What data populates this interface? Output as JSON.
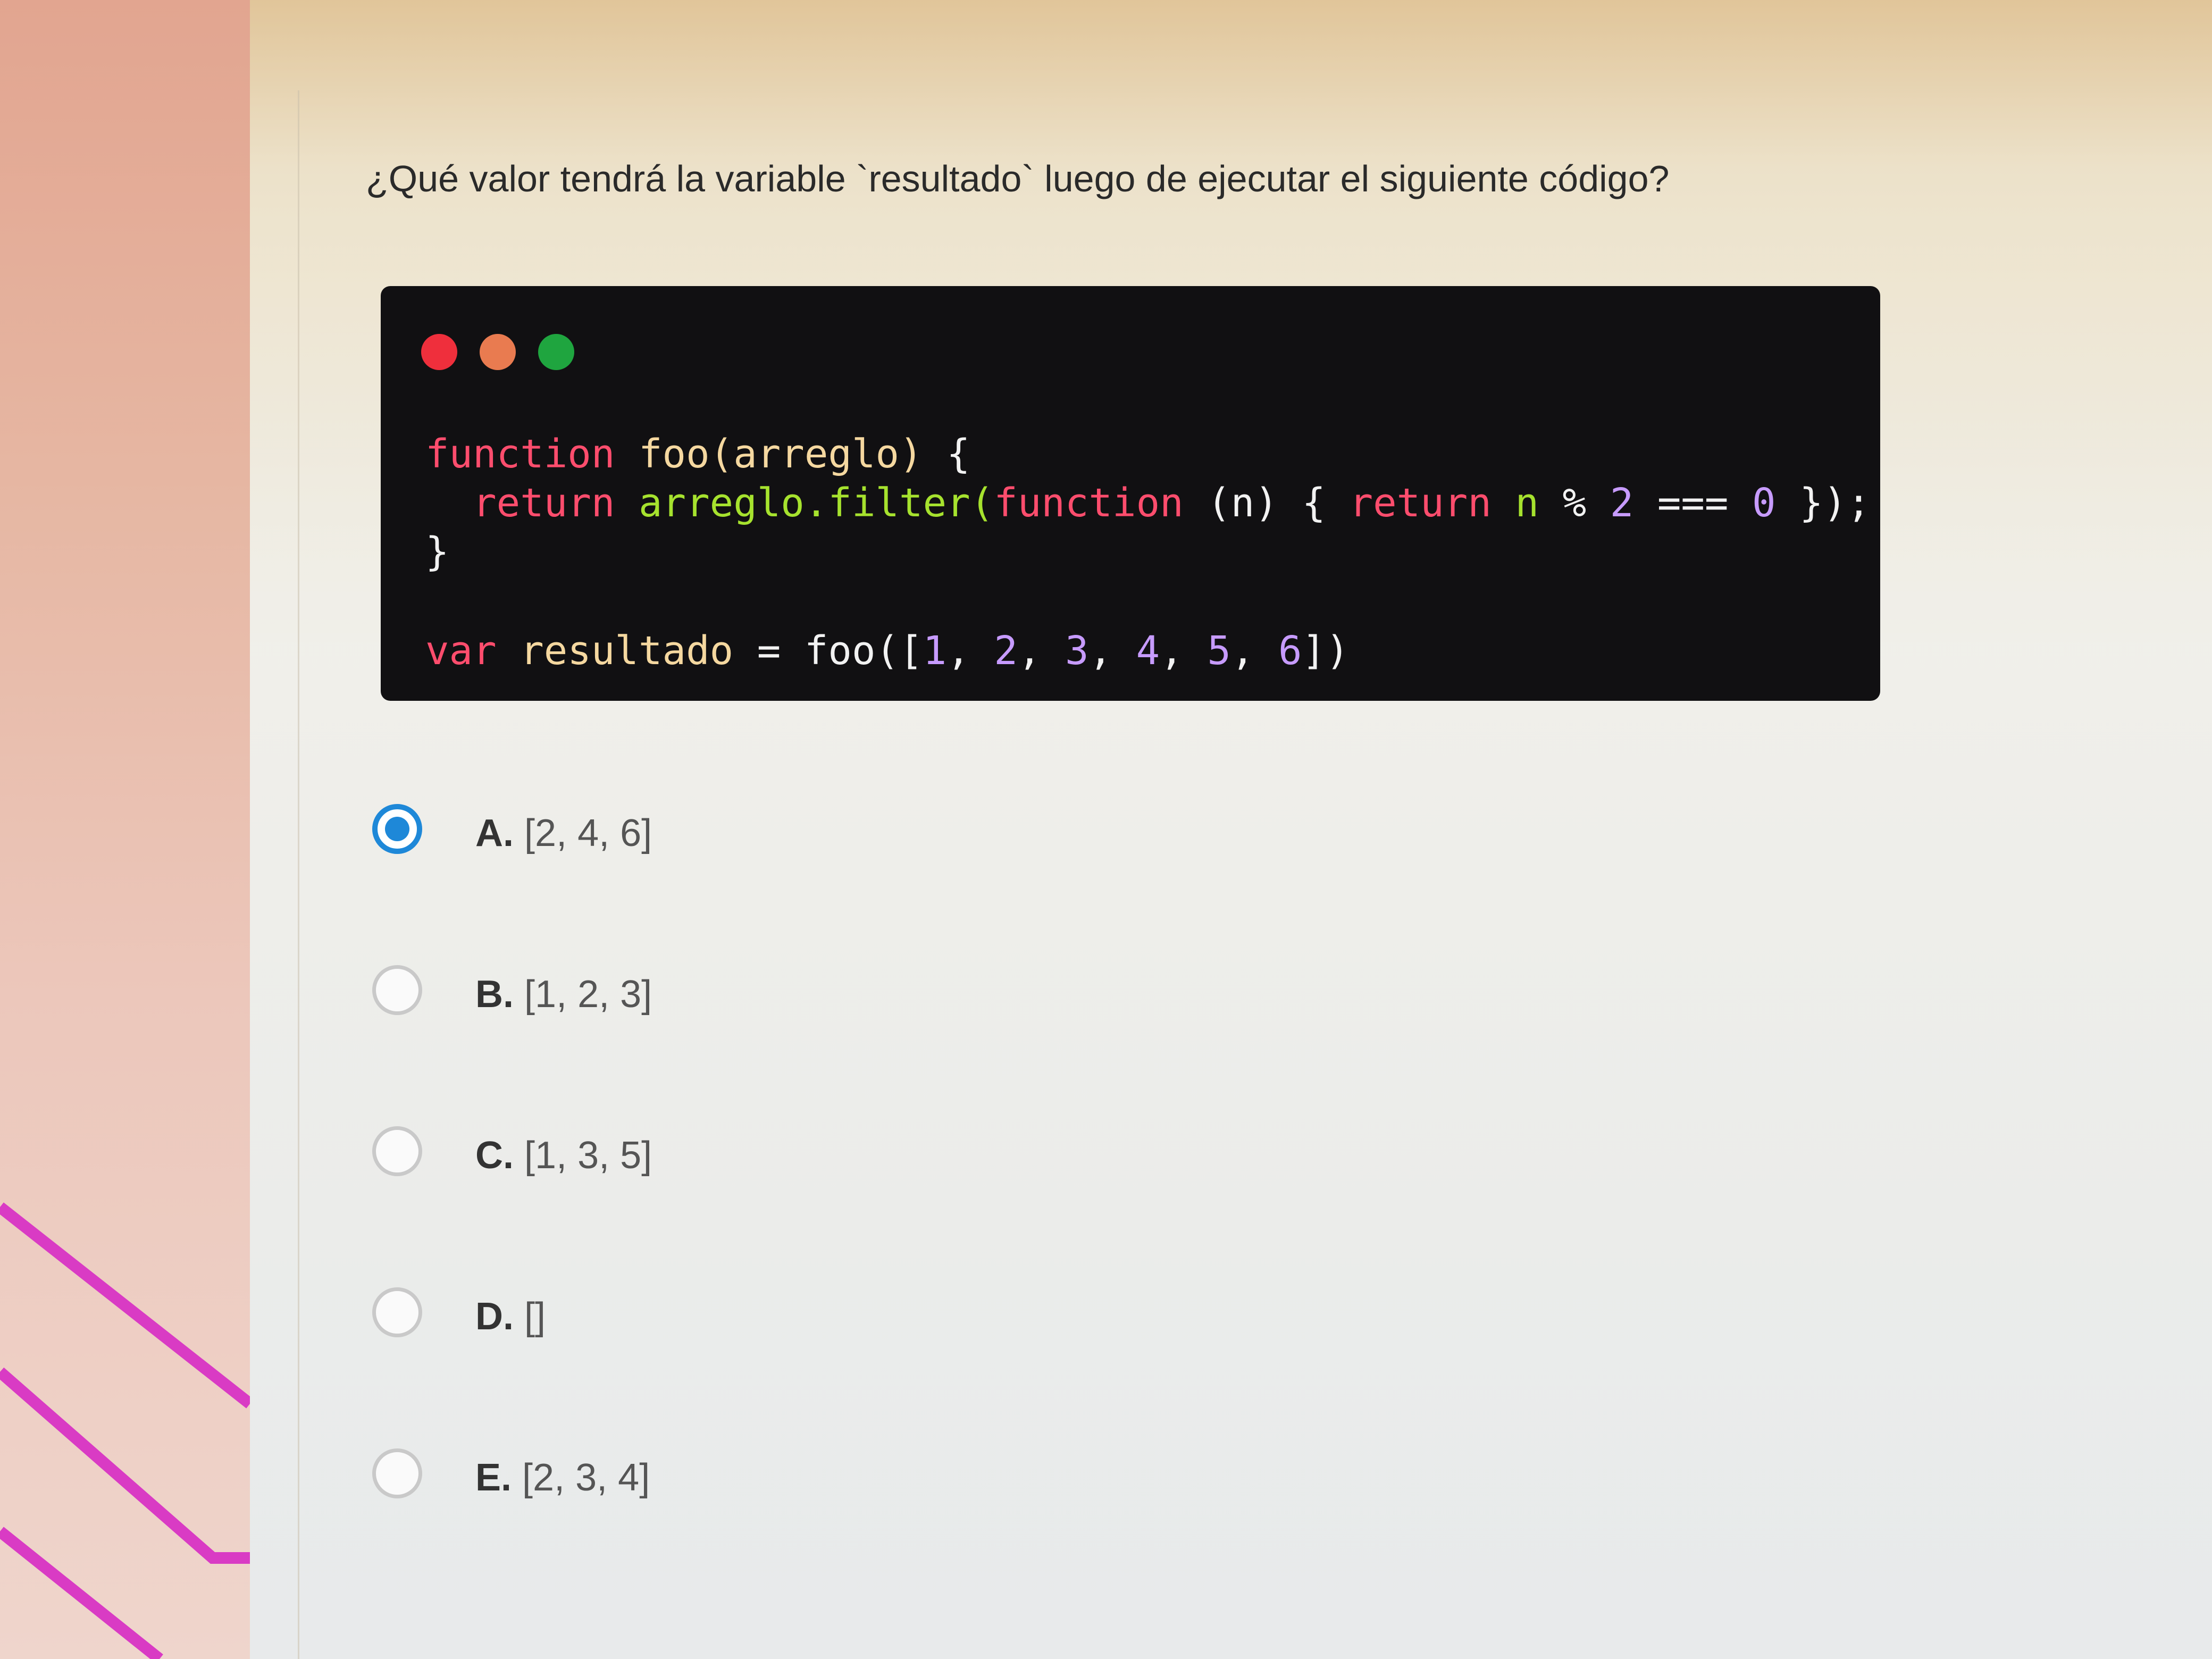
{
  "question": "¿Qué valor tendrá la variable `resultado` luego de ejecutar el siguiente código?",
  "code": {
    "line1": {
      "kw": "function",
      "name": "foo(arreglo)",
      "brace": "{"
    },
    "line2": {
      "kw1": "return",
      "call": "arreglo.filter(",
      "kw2": "function",
      "param": "(n) {",
      "kw3": "return",
      "var": "n",
      "op": "%",
      "num1": "2",
      "eq": "===",
      "num2": "0",
      "end": "});"
    },
    "line3": "}",
    "line4": {
      "kw": "var",
      "var": "resultado",
      "eq": "=",
      "call": "foo([",
      "n1": "1",
      "n2": "2",
      "n3": "3",
      "n4": "4",
      "n5": "5",
      "n6": "6",
      "end": "])"
    }
  },
  "options": [
    {
      "letter": "A.",
      "value": "[2, 4, 6]",
      "selected": true
    },
    {
      "letter": "B.",
      "value": "[1, 2, 3]",
      "selected": false
    },
    {
      "letter": "C.",
      "value": "[1, 3, 5]",
      "selected": false
    },
    {
      "letter": "D.",
      "value": "[]",
      "selected": false
    },
    {
      "letter": "E.",
      "value": "[2, 3, 4]",
      "selected": false
    }
  ],
  "colors": {
    "radio_selected": "#1e88d8",
    "decor_stripe": "#d93bc4",
    "code_bg": "#111012",
    "dot_red": "#ef2f3c",
    "dot_orange": "#e97b50",
    "dot_green": "#1fa53f"
  }
}
